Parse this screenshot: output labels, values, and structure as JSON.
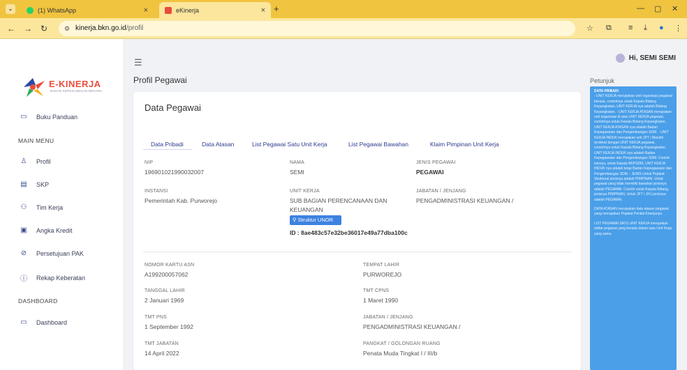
{
  "browser": {
    "tabs": [
      {
        "label": "(1) WhatsApp"
      },
      {
        "label": "eKinerja"
      }
    ],
    "url_host": "kinerja.bkn.go.id",
    "url_path": "/profil"
  },
  "sidebar": {
    "logo_text": "E-KINERJA",
    "logo_sub": "BADAN KEPEGAWAIAN NEGARA",
    "guide": "Buku Panduan",
    "main_menu_head": "MAIN MENU",
    "items": [
      {
        "label": "Profil",
        "icon": "person-icon"
      },
      {
        "label": "SKP",
        "icon": "document-icon"
      },
      {
        "label": "Tim Kerja",
        "icon": "team-icon"
      },
      {
        "label": "Angka Kredit",
        "icon": "file-icon"
      },
      {
        "label": "Persetujuan PAK",
        "icon": "check-circle-icon"
      },
      {
        "label": "Rekap Keberatan",
        "icon": "info-icon"
      }
    ],
    "dashboard_head": "DASHBOARD",
    "dashboard": "Dashboard"
  },
  "header": {
    "page_title": "Profil Pegawai",
    "user_greeting": "Hi, SEMI SEMI"
  },
  "card": {
    "title": "Data Pegawai",
    "tabs": [
      "Data Pribadi",
      "Data Atasan",
      "List Pegawai Satu Unit Kerja",
      "List Pegawai Bawahan",
      "Klaim Pimpinan Unit Kerja"
    ],
    "nip_label": "NIP",
    "nip": "196901021990032007",
    "nama_label": "NAMA",
    "nama": "SEMI",
    "jenis_label": "JENIS PEGAWAI",
    "jenis": "PEGAWAI",
    "instansi_label": "INSTANSI",
    "instansi": "Pemerintah Kab. Purworejo",
    "unit_label": "UNIT KERJA",
    "unit_line1": "SUB BAGIAN PERENCANAAN DAN",
    "unit_line2": "KEUANGAN",
    "unor_button": "Struktur UNOR",
    "id_line": "ID : 8ae483c57e32be36017e49a77dba100c",
    "jabatan_label": "JABATAN / JENJANG",
    "jabatan": "PENGADMINISTRASI KEUANGAN /",
    "kartu_label": "NOMOR KARTU ASN",
    "kartu": "A199200057062",
    "tempat_label": "TEMPAT LAHIR",
    "tempat": "PURWOREJO",
    "tgl_label": "TANGGAL LAHIR",
    "tgl": "2 Januari 1969",
    "tmtcpns_label": "TMT CPNS",
    "tmtcpns": "1 Maret 1990",
    "tmtpns_label": "TMT PNS",
    "tmtpns": "1 September 1992",
    "jabatan2_label": "JABATAN / JENJANG",
    "jabatan2": "PENGADMINISTRASI KEUANGAN /",
    "tmtjab_label": "TMT JABATAN",
    "tmtjab": "14 April 2022",
    "pangkat_label": "PANGKAT / GOLONGAN RUANG",
    "pangkat": "Penata Muda Tingkat I / III/b"
  },
  "help": {
    "title": "Petunjuk",
    "p1_head": "DATA PRIBADI",
    "p1": "- UNIT KERJA merupakan unit organisasi pegawai berada, contohnya untuk Kepala Bidang Kepangkatan, UNIT KERJA nya adalah Bidang Kepangkatan. - UNIT KERJA ATASAN merupakan unit organisasi di atas UNIT KERJA pegawai, contohnya untuk Kepala Bidang Kepangkatan, UNIT KERJA ATASAN nya adalah Badan Kepegawaian dan Pengembangan SDM. - UNIT KERJA INDUK merupakan unit JPT / Mandiri terdekat dengan UNIT KERJA pegawai, contohnya untuk Kepala Bidang Kepangkatan, UNIT KERJA INDUK nya adalah Badan Kepegawaian dan Pengembangan SDM. Contoh lainnya, untuk Kepala BKPSDM, UNIT KERJA INDUK nya adalah tetap Badan Kepegawaian dan Pengembangan SDM. - JENIS Untuk Pejabat Struktural jenisnya adalah PIMPINAN. Untuk pegawai yang tidak memiliki bawahan jenisnya adalah PEGAWAI. Contoh untuk Kepala Bidang, jenisnya PIMPINAN. Untuk JFT / JFU jenisnya adalah PEGAWAI.",
    "p2": "DATA ATASAN merupakan data atasan pegawai yang merupakan Pejabat Penilai Kinerjanya",
    "p3": "LIST PEGAWAI SATU UNIT KERJA merupakan daftar pegawai yang berada dalam satu Unit Kerja yang sama"
  }
}
